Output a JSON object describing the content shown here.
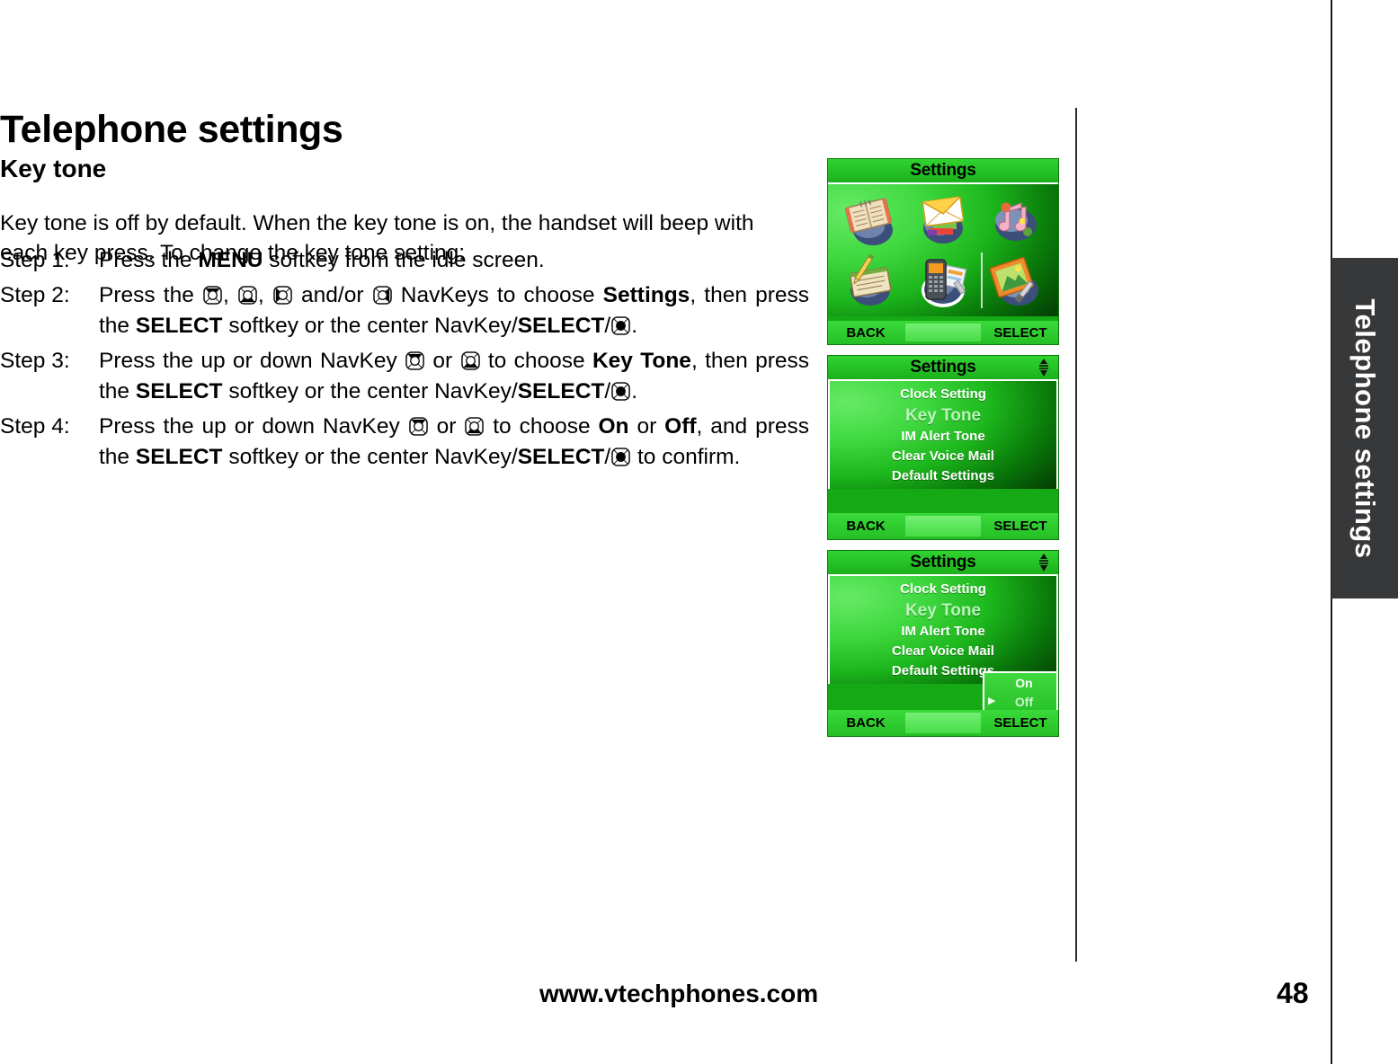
{
  "document": {
    "chapter_tab": "Telephone settings",
    "title": "Telephone settings",
    "subtitle": "Key tone",
    "intro": "Key tone is off by default. When the key tone is on, the handset will beep with each key press. To change the key tone setting:",
    "footer_url": "www.vtechphones.com",
    "page_number": "48"
  },
  "steps": [
    {
      "label": "Step 1:",
      "parts": [
        {
          "t": "Press the ",
          "b": false
        },
        {
          "t": "MENU",
          "b": true
        },
        {
          "t": " softkey from the idle screen.",
          "b": false
        }
      ]
    },
    {
      "label": "Step 2:",
      "parts": [
        {
          "t": "Press the ",
          "b": false
        },
        {
          "icon": "navkey-up-icon"
        },
        {
          "t": ", ",
          "b": false
        },
        {
          "icon": "navkey-down-icon"
        },
        {
          "t": ", ",
          "b": false
        },
        {
          "icon": "navkey-left-icon"
        },
        {
          "t": " and/or ",
          "b": false
        },
        {
          "icon": "navkey-right-icon"
        },
        {
          "t": " NavKeys to choose ",
          "b": false
        },
        {
          "t": "Settings",
          "b": true
        },
        {
          "t": ", then press the ",
          "b": false
        },
        {
          "t": "SELECT",
          "b": true
        },
        {
          "t": " softkey or the center NavKey/",
          "b": false
        },
        {
          "t": "SELECT",
          "b": true
        },
        {
          "t": "/",
          "b": false
        },
        {
          "icon": "navkey-center-icon"
        },
        {
          "t": ".",
          "b": false
        }
      ]
    },
    {
      "label": "Step 3:",
      "parts": [
        {
          "t": "Press the up or down NavKey ",
          "b": false
        },
        {
          "icon": "navkey-up-icon"
        },
        {
          "t": " or ",
          "b": false
        },
        {
          "icon": "navkey-down-icon"
        },
        {
          "t": " to choose ",
          "b": false
        },
        {
          "t": "Key Tone",
          "b": true
        },
        {
          "t": ", then press the ",
          "b": false
        },
        {
          "t": "SELECT",
          "b": true
        },
        {
          "t": " softkey or the center NavKey/",
          "b": false
        },
        {
          "t": "SELECT",
          "b": true
        },
        {
          "t": "/",
          "b": false
        },
        {
          "icon": "navkey-center-icon"
        },
        {
          "t": ".",
          "b": false
        }
      ]
    },
    {
      "label": "Step 4:",
      "parts": [
        {
          "t": "Press the up or down NavKey ",
          "b": false
        },
        {
          "icon": "navkey-up-icon"
        },
        {
          "t": " or ",
          "b": false
        },
        {
          "icon": "navkey-down-icon"
        },
        {
          "t": " to choose ",
          "b": false
        },
        {
          "t": "On",
          "b": true
        },
        {
          "t": " or ",
          "b": false
        },
        {
          "t": "Off",
          "b": true
        },
        {
          "t": ", and press the ",
          "b": false
        },
        {
          "t": "SELECT",
          "b": true
        },
        {
          "t": " softkey or the center NavKey/",
          "b": false
        },
        {
          "t": "SELECT",
          "b": true
        },
        {
          "t": "/",
          "b": false
        },
        {
          "icon": "navkey-center-icon"
        },
        {
          "t": " to confirm.",
          "b": false
        }
      ]
    }
  ],
  "screens": [
    {
      "id": "settings-icon-grid",
      "title": "Settings",
      "has_scroll_glyph": false,
      "icons": [
        "phonebook-icon",
        "message-envelope-icon",
        "music-note-icon",
        "notepad-pencil-icon",
        "handset-settings-icon",
        "picture-frame-icon"
      ],
      "selected_icon": "handset-settings-icon",
      "softkeys": {
        "left": "BACK",
        "right": "SELECT"
      }
    },
    {
      "id": "settings-menu-list",
      "title": "Settings",
      "has_scroll_glyph": true,
      "menu": [
        "Clock Setting",
        "Key Tone",
        "IM Alert Tone",
        "Clear Voice Mail",
        "Default Settings"
      ],
      "selected_menu": "Key Tone",
      "softkeys": {
        "left": "BACK",
        "right": "SELECT"
      }
    },
    {
      "id": "settings-key-tone-popup",
      "title": "Settings",
      "has_scroll_glyph": true,
      "menu": [
        "Clock Setting",
        "Key Tone",
        "IM Alert Tone",
        "Clear Voice Mail",
        "Default Settings"
      ],
      "selected_menu": "Key Tone",
      "popup": {
        "options": [
          "On",
          "Off"
        ],
        "marked": "Off"
      },
      "softkeys": {
        "left": "BACK",
        "right": "SELECT"
      }
    }
  ],
  "colors": {
    "screen_green": "#16a916",
    "title_bar_green": "#27c427",
    "tab_dark": "#37383a",
    "selected_text": "#b9f5b9"
  }
}
